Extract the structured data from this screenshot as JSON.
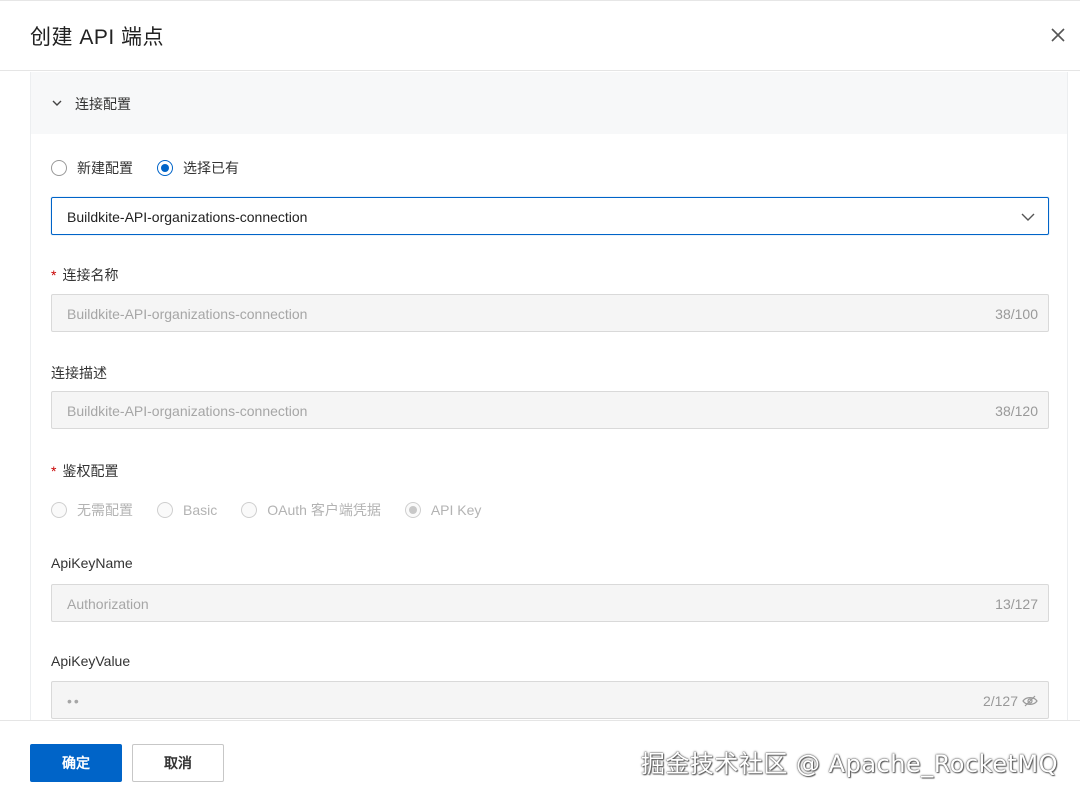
{
  "dialog": {
    "title": "创建 API 端点"
  },
  "section": {
    "title": "连接配置"
  },
  "mode_radios": [
    {
      "label": "新建配置",
      "checked": false
    },
    {
      "label": "选择已有",
      "checked": true
    }
  ],
  "connection_select": {
    "value": "Buildkite-API-organizations-connection"
  },
  "fields": {
    "name": {
      "label": "连接名称",
      "required": true,
      "value": "Buildkite-API-organizations-connection",
      "counter": "38/100"
    },
    "description": {
      "label": "连接描述",
      "value": "Buildkite-API-organizations-connection",
      "counter": "38/120"
    },
    "auth": {
      "label": "鉴权配置",
      "required": true,
      "options": [
        {
          "label": "无需配置",
          "checked": false
        },
        {
          "label": "Basic",
          "checked": false
        },
        {
          "label": "OAuth 客户端凭据",
          "checked": false
        },
        {
          "label": "API Key",
          "checked": true
        }
      ]
    },
    "api_key_name": {
      "label": "ApiKeyName",
      "value": "Authorization",
      "counter": "13/127"
    },
    "api_key_value": {
      "label": "ApiKeyValue",
      "value": "••",
      "counter": "2/127"
    }
  },
  "footer": {
    "confirm_label": "确定",
    "cancel_label": "取消",
    "watermark": "掘金技术社区 @ Apache_RocketMQ"
  },
  "colors": {
    "primary": "#0064c8",
    "required": "#c80000"
  },
  "icons": [
    "close-icon",
    "chevron-down-icon",
    "select-arrow-icon",
    "eye-off-icon"
  ]
}
